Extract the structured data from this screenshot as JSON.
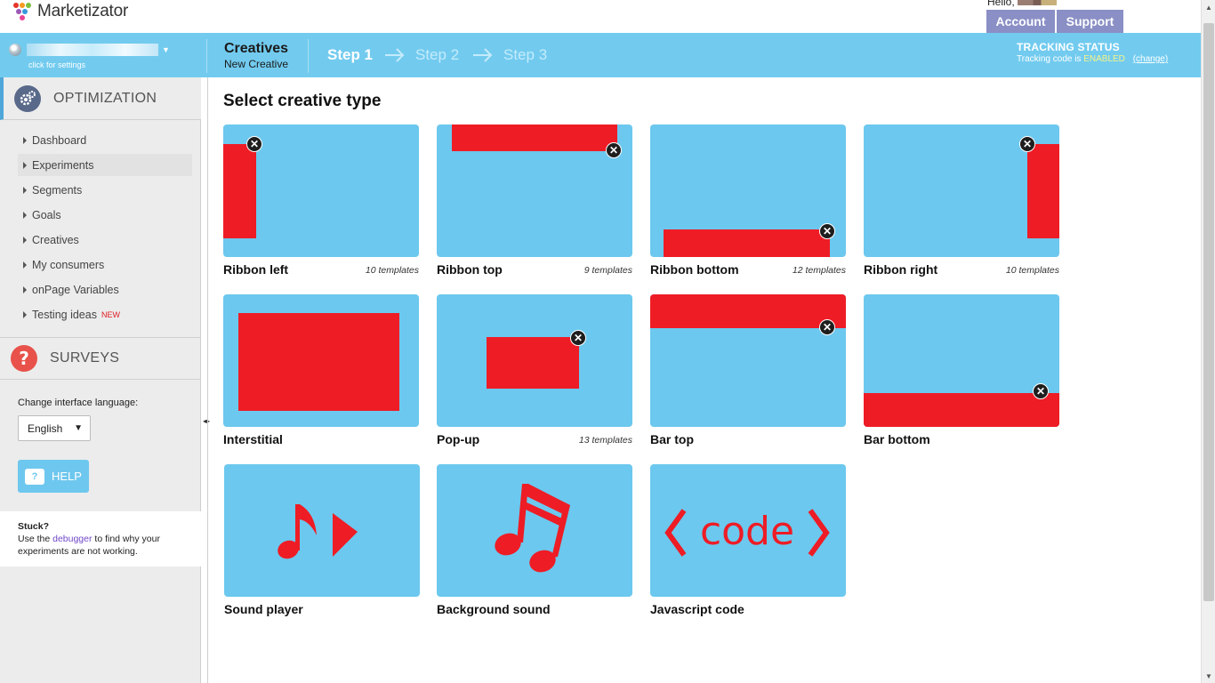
{
  "header": {
    "logo_text": "Marketizator",
    "hello": "Hello,",
    "account_label": "Account",
    "support_label": "Support"
  },
  "bar": {
    "click_settings": "click for settings",
    "section_title": "Creatives",
    "section_sub": "New Creative",
    "steps": [
      "Step 1",
      "Step 2",
      "Step 3"
    ],
    "tracking_title": "TRACKING STATUS",
    "tracking_prefix": "Tracking code is",
    "tracking_state": "ENABLED",
    "tracking_change": "(change)"
  },
  "sidebar": {
    "optimization_label": "OPTIMIZATION",
    "nav": [
      {
        "label": "Dashboard"
      },
      {
        "label": "Experiments"
      },
      {
        "label": "Segments"
      },
      {
        "label": "Goals"
      },
      {
        "label": "Creatives"
      },
      {
        "label": "My consumers"
      },
      {
        "label": "onPage Variables"
      },
      {
        "label": "Testing ideas",
        "badge": "NEW"
      }
    ],
    "surveys_label": "SURVEYS",
    "language_label": "Change interface language:",
    "language_value": "English",
    "help_label": "HELP",
    "stuck_title": "Stuck?",
    "stuck_pre": "Use the",
    "stuck_link": "debugger",
    "stuck_post": "to find why your experiments are not working."
  },
  "main": {
    "title": "Select creative type",
    "creatives": [
      {
        "label": "Ribbon left",
        "count": "10 templates"
      },
      {
        "label": "Ribbon top",
        "count": "9 templates"
      },
      {
        "label": "Ribbon bottom",
        "count": "12 templates"
      },
      {
        "label": "Ribbon right",
        "count": "10 templates"
      },
      {
        "label": "Interstitial",
        "count": ""
      },
      {
        "label": "Pop-up",
        "count": "13 templates"
      },
      {
        "label": "Bar top",
        "count": ""
      },
      {
        "label": "Bar bottom",
        "count": ""
      },
      {
        "label": "Sound player",
        "count": ""
      },
      {
        "label": "Background sound",
        "count": ""
      },
      {
        "label": "Javascript code",
        "count": "",
        "icon_text": "code"
      }
    ]
  },
  "colors": {
    "brand_blue": "#72cbef",
    "card_blue": "#6cc8ee",
    "accent_red": "#ee1c25",
    "button_purple": "#8a8fc5"
  }
}
